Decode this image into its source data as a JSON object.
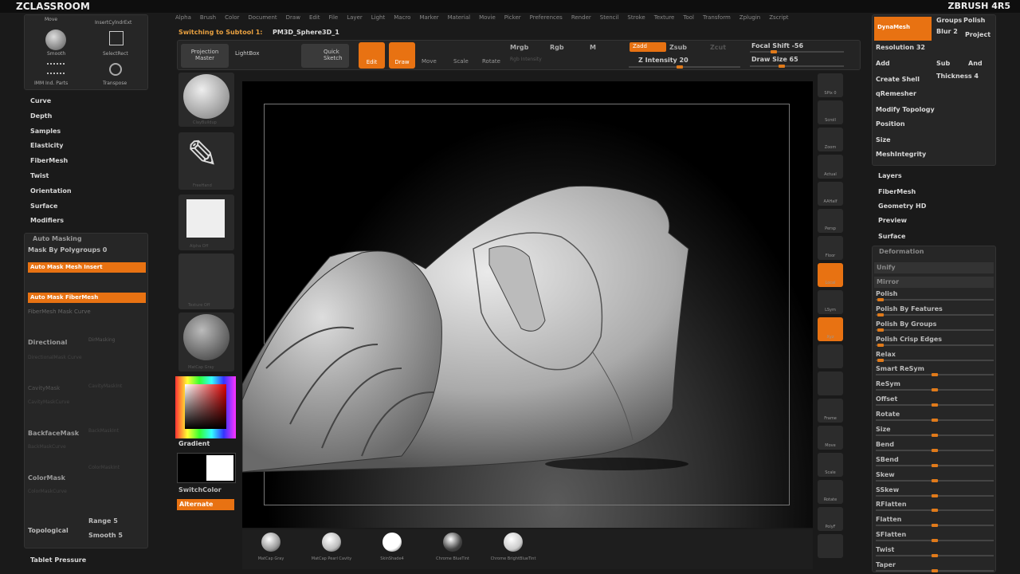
{
  "app": {
    "title": "ZCLASSROOM",
    "brand": "ZBRUSH 4R5"
  },
  "menu": [
    "Alpha",
    "Brush",
    "Color",
    "Document",
    "Draw",
    "Edit",
    "File",
    "Layer",
    "Light",
    "Macro",
    "Marker",
    "Material",
    "Movie",
    "Picker",
    "Preferences",
    "Render",
    "Stencil",
    "Stroke",
    "Texture",
    "Tool",
    "Transform",
    "Zplugin",
    "Zscript"
  ],
  "topbar": {
    "status": "Switching to Subtool 1:",
    "subtool": "PM3D_Sphere3D_1"
  },
  "toolbar": {
    "projection_master": "Projection Master",
    "lightbox": "LightBox",
    "quick_sketch": "Quick Sketch",
    "edit": "Edit",
    "draw": "Draw",
    "move": "Move",
    "scale": "Scale",
    "rotate": "Rotate",
    "mrgb": "Mrgb",
    "rgb": "Rgb",
    "m": "M",
    "rgb_intensity": "Rgb Intensity",
    "zadd": "Zadd",
    "zsub": "Zsub",
    "zcut": "Zcut",
    "z_intensity": "Z Intensity 20",
    "focal_shift": "Focal Shift -56",
    "draw_size": "Draw Size 65"
  },
  "tl_panel": {
    "brush1": "Move",
    "brush2": "InsertCylndrExt",
    "brush3": "Smooth",
    "brush4": "SelectRect",
    "brush5": "IMM Ind. Parts",
    "brush6": "Transpose"
  },
  "left_items": [
    "Curve",
    "Depth",
    "Samples",
    "Elasticity",
    "FiberMesh",
    "Twist",
    "Orientation",
    "Surface",
    "Modifiers"
  ],
  "automask": {
    "title": "Auto Masking",
    "mask_polygroups": "Mask By Polygroups 0",
    "mesh_insert": "Auto Mask Mesh Insert",
    "fibermesh": "Auto Mask FiberMesh",
    "fibermesh_curve": "FiberMesh Mask Curve",
    "directional": "Directional",
    "dir_val": "DirMasking",
    "dir_curve": "DirectionalMask Curve",
    "cavity": "CavityMask",
    "cavity_val": "CavityMaskInt",
    "cavity_curve": "CavityMaskCurve",
    "backface": "BackfaceMask",
    "backface_val": "BackMaskInt",
    "backface_curve": "BackMaskCurve",
    "colormask": "ColorMask",
    "colormask_val": "ColorMaskInt",
    "colormask_curve": "ColorMaskCurve",
    "topological": "Topological",
    "range": "Range 5",
    "smooth": "Smooth 5"
  },
  "bottom_left": "Tablet Pressure",
  "palette": {
    "brush": "ClayBuildup",
    "stroke": "FreeHand",
    "alpha": "Alpha Off",
    "texture": "Texture Off",
    "material": "MatCap Gray",
    "gradient": "Gradient",
    "switchcolor": "SwitchColor",
    "alternate": "Alternate"
  },
  "shelf": [
    "MatCap Gray",
    "MatCap Pearl Cavity",
    "SkinShade4",
    "Chrome BlueTint",
    "Chrome BrightBlueTint"
  ],
  "right_tools": [
    "SPix 0",
    "Scroll",
    "Zoom",
    "Actual",
    "AAHalf",
    "Persp",
    "Floor",
    "Local",
    "LSym",
    "Xyz",
    "",
    "",
    "Frame",
    "Move",
    "Scale",
    "Rotate",
    "PolyF",
    ""
  ],
  "rp": {
    "dynamesh": "DynaMesh",
    "groups": "Groups",
    "polish": "Polish",
    "blur": "Blur 2",
    "project": "Project",
    "resolution": "Resolution 32",
    "add": "Add",
    "sub": "Sub",
    "and": "And",
    "create_shell": "Create Shell",
    "thickness": "Thickness 4",
    "qremesher": "qRemesher",
    "modify_topology": "Modify Topology",
    "position": "Position",
    "size": "Size",
    "meshintegrity": "MeshIntegrity",
    "layers": "Layers",
    "fibermesh": "FiberMesh",
    "geometry_hd": "Geometry HD",
    "preview": "Preview",
    "surface": "Surface",
    "deformation": "Deformation",
    "unify": "Unify",
    "mirror": "Mirror",
    "polish2": "Polish",
    "polish_features": "Polish By Features",
    "polish_groups": "Polish By Groups",
    "polish_crisp": "Polish Crisp Edges",
    "relax": "Relax",
    "smart_resym": "Smart ReSym",
    "resym": "ReSym",
    "offset": "Offset",
    "rotate": "Rotate",
    "size2": "Size",
    "bend": "Bend",
    "sbend": "SBend",
    "skew": "Skew",
    "sskew": "SSkew",
    "rflatten": "RFlatten",
    "flatten": "Flatten",
    "sflatten": "SFlatten",
    "twist": "Twist",
    "taper": "Taper"
  },
  "colors": {
    "accent": "#e87212"
  }
}
